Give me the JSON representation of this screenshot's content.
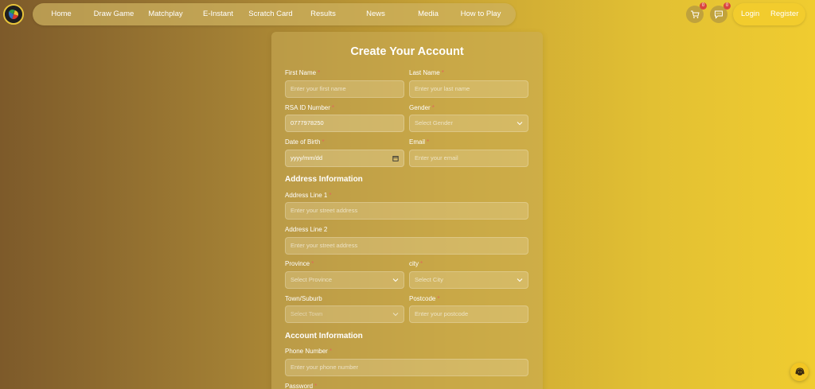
{
  "nav": {
    "items": [
      "Home",
      "Draw Game",
      "Matchplay",
      "E-Instant",
      "Scratch Card",
      "Results",
      "News",
      "Media",
      "How to Play"
    ]
  },
  "header": {
    "cart_count": "0",
    "messages_count": "0",
    "login_label": "Login",
    "register_label": "Register"
  },
  "form": {
    "title": "Create Your Account",
    "required_mark": "*",
    "first_name": {
      "label": "First Name",
      "placeholder": "Enter your first name"
    },
    "last_name": {
      "label": "Last Name",
      "placeholder": "Enter your last name"
    },
    "rsa_id": {
      "label": "RSA ID Number",
      "value": "0777978250"
    },
    "gender": {
      "label": "Gender",
      "selected": "Select Gender"
    },
    "dob": {
      "label": "Date of Birth",
      "value": "yyyy/mm/dd"
    },
    "email": {
      "label": "Email",
      "placeholder": "Enter your email"
    },
    "address_section": "Address Information",
    "address1": {
      "label": "Address Line 1",
      "placeholder": "Enter your street address"
    },
    "address2": {
      "label": "Address Line 2",
      "placeholder": "Enter your street address"
    },
    "province": {
      "label": "Province",
      "selected": "Select Province"
    },
    "city": {
      "label": "city",
      "selected": "Select City"
    },
    "town": {
      "label": "Town/Suburb",
      "selected": "Select Town"
    },
    "postcode": {
      "label": "Postcode",
      "placeholder": "Enter your postcode"
    },
    "account_section": "Account Information",
    "phone": {
      "label": "Phone Number",
      "placeholder": "Enter your phone number"
    },
    "password": {
      "label": "Password"
    }
  },
  "colors": {
    "accent": "#f2cc2d",
    "required": "#e06a5a",
    "badge": "#d9453e"
  }
}
